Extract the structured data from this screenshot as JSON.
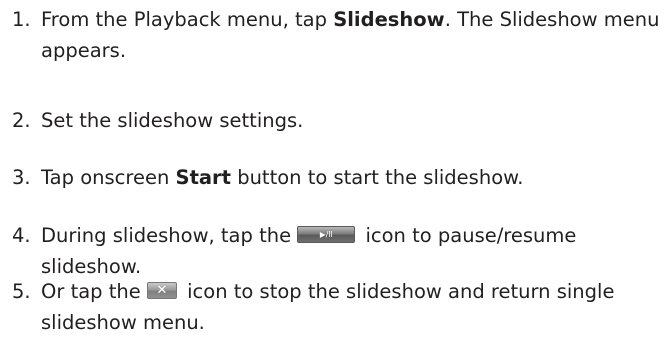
{
  "steps": [
    {
      "number": "1.",
      "before": "From the Playback menu, tap ",
      "bold": "Slideshow",
      "after": ". The Slideshow menu appears."
    },
    {
      "number": "2.",
      "text": "Set the slideshow settings."
    },
    {
      "number": "3.",
      "before": "Tap onscreen ",
      "bold": "Start",
      "after": " button to start the slideshow."
    },
    {
      "number": "4.",
      "before": "During slideshow, tap the ",
      "icon_name": "play-pause-icon",
      "icon_glyph": "▶/II",
      "after": " icon to pause/resume slideshow."
    },
    {
      "number": "5.",
      "before": "Or tap the ",
      "icon_name": "close-icon",
      "icon_glyph": "✕",
      "after": " icon to stop the slideshow and return single slideshow menu."
    }
  ]
}
